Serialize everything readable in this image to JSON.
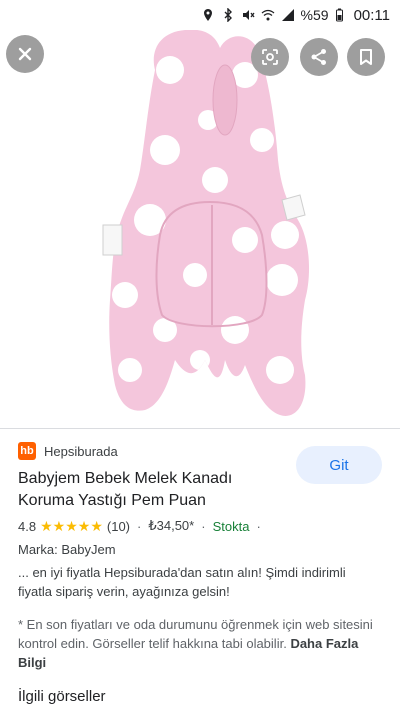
{
  "status_bar": {
    "battery": "%59",
    "time": "00:11"
  },
  "viewer": {
    "icons": {
      "close": "close-icon",
      "lens": "lens-icon",
      "share": "share-icon",
      "save": "bookmark-icon"
    }
  },
  "details": {
    "source_logo": "hb",
    "source_name": "Hepsiburada",
    "go_label": "Git",
    "title": "Babyjem Bebek Melek Kanadı Koruma Yastığı Pem Puan",
    "rating_value": "4.8",
    "rating": 4.8,
    "review_count": "(10)",
    "price": "₺34,50*",
    "stock": "Stokta",
    "brand": "Marka: BabyJem",
    "description": "... en iyi fiyatla Hepsiburada'dan satın alın! Şimdi indirimli fiyatla sipariş verin, ayağınıza gelsin!",
    "disclaimer": "* En son fiyatları ve oda durumunu öğrenmek için web sitesini kontrol edin. Görseller telif hakkına tabi olabilir.",
    "more_link": "Daha Fazla Bilgi"
  },
  "related_title": "İlgili görseller",
  "colors": {
    "accent": "#1a73e8",
    "brand": "#ff6000",
    "star": "#fbbc04",
    "stock": "#188038",
    "pillow": "#f4c6dc"
  }
}
